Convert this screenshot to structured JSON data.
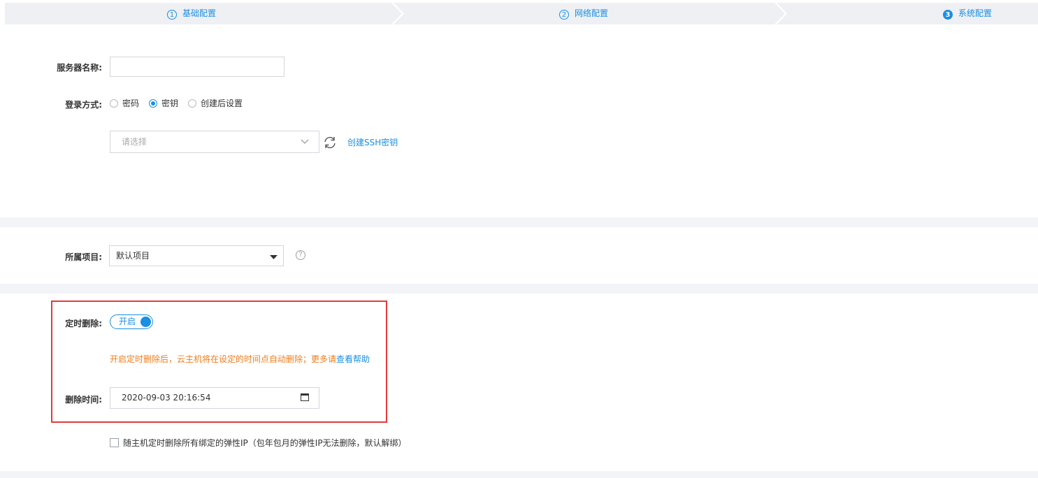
{
  "steps": [
    {
      "num": "1",
      "label": "基础配置",
      "state": "inactive"
    },
    {
      "num": "2",
      "label": "网络配置",
      "state": "inactive"
    },
    {
      "num": "3",
      "label": "系统配置",
      "state": "active"
    }
  ],
  "colors": {
    "accent": "#1a8fe3",
    "warning": "#f07d1a",
    "highlight_border": "#e5393a"
  },
  "server_name": {
    "label": "服务器名称:",
    "value": ""
  },
  "login": {
    "label": "登录方式:",
    "options": [
      "密码",
      "密钥",
      "创建后设置"
    ],
    "selected": "密钥"
  },
  "key_select": {
    "placeholder": "请选择",
    "create_link": "创建SSH密钥"
  },
  "project": {
    "label": "所属项目:",
    "value": "默认项目"
  },
  "timed_delete": {
    "label": "定时删除:",
    "toggle_label": "开启",
    "enabled": true,
    "warning_text": "开启定时删除后，云主机将在设定的时间点自动删除；更多请",
    "help_link": "查看帮助",
    "time_label": "删除时间:",
    "time_value": "2020-09-03 20:16:54"
  },
  "eip_checkbox": {
    "label": "随主机定时删除所有绑定的弹性IP（包年包月的弹性IP无法删除，默认解绑）",
    "checked": false
  }
}
